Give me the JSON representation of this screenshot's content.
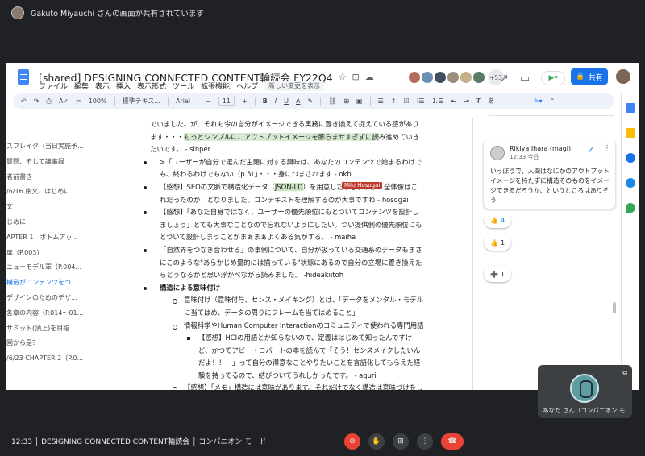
{
  "top_bar": {
    "text": "Gakuto Miyauchi さんの画面が共有されています"
  },
  "doc": {
    "title": "[shared] DESIGNING CONNECTED CONTENT輪読会 FY22Q4",
    "menus": [
      "ファイル",
      "編集",
      "表示",
      "挿入",
      "表示形式",
      "ツール",
      "拡張機能",
      "ヘルプ"
    ],
    "last_edit": "新しい変更を表示",
    "collaborator_count": "+53",
    "share_label": "共有"
  },
  "toolbar": {
    "zoom": "100%",
    "style": "標準テキス...",
    "font": "Arial",
    "font_size": "11",
    "bold": "B",
    "italic": "I",
    "underline": "U",
    "text_color": "A",
    "input_tools": "あ"
  },
  "outline": [
    {
      "label": "スブレイク（当日実施予..."
    },
    {
      "label": "質問、そして議事録"
    },
    {
      "label": "者前書き"
    },
    {
      "label": "/6/16 序文、はじめに..."
    },
    {
      "label": "文"
    },
    {
      "label": "じめに"
    },
    {
      "label": "APTER 1　ボトムアッ..."
    },
    {
      "label": "扉（P.003）"
    },
    {
      "label": "ニューモデル軍（P.004..."
    },
    {
      "label": "構造がコンテンツをつ..."
    },
    {
      "label": "デザインのためのデザ..."
    },
    {
      "label": "各章の内容（P.014〜01..."
    },
    {
      "label": "サミット(頂上)を目指..."
    },
    {
      "label": "固から是？"
    },
    {
      "label": "/6/23 CHAPTER 2（P.0..."
    }
  ],
  "body": {
    "l1a": "でいました。が、それも今の自分がイメージできる実務に置き換えて捉えている感",
    "l1b": "があります・・・",
    "l1c": "もっとシンプルに、アウトプットイメージを膨らませすぎずに読",
    "l1d": "み進めていきたいです。 - sinper",
    "b2": ">「ユーザーが自分で選んだ主題に対する興味は、あなたのコンテンツで始まるわけでも、終わるわけでもない（p.5）」・・・身につまされます - okb",
    "b3a": "【感想】SEOの文脈で構造化データ（",
    "b3b": "JSON-LD",
    "b3c": "）を用意したりしますが、全体像はこれだったのか！となりました。コンテキストを理解するのが大事ですね - hosogai",
    "b4": "【感想】「あなた自身ではなく、ユーザーの優先順位にもとづいてコンテンツを設計しましょう」とても大事なことなので忘れないようにしたい。つい提供側の優先順位にもとづいて設計しまうことがまぁまぁよくある気がする。 - maiha",
    "b5": "「自然界をつなぎ合わせる」の事例について、自分が扱っている交通系のデータもまさにこのような\"あらかじめ量的には揃っている\"状態にあるので自分の立場に置き換えたらどうなるかと思い浮かべながら読みました。 -hideakiitoh",
    "b6": "構造による意味付け",
    "s1": "意味付け（意味付与、センス・メイキング）とは、「データをメンタル・モデルに当てはめ、データの周りにフレームを当てはめること」",
    "s2": "情報科学やHuman Computer Interactionのコミュニティで使われる専門用語",
    "s3": "【感想】HCIの用語とか知らないので、定義ははじめて知ったんですけど、かつてアビー・コバートの本を読んで「そう！センスメイクしたいんだよ！！！」って自分の得意なことやりたいことを言語化してもらえた経験を持ってるので、結びついてうれしかったです。 - aguri",
    "s4": "【感想】「メモ」構造には意味があります。それだけでなく構造は意味づけをします。」情報やデータ単体でなく、関係性によって繋げることで意味を"
  },
  "cursor_label": "Miki Hosogai",
  "comment": {
    "name": "Rikiya Ihara (magi)",
    "time": "12:33 今日",
    "text": "いっぽうで、人間はなにかのアウトプットイメージを持たずに構造そのものをイメージできるだろうか、というところはありそう"
  },
  "reactions": [
    {
      "icon": "👍",
      "count": "4"
    },
    {
      "icon": "👍",
      "count": "1"
    },
    {
      "icon": "➕",
      "count": "1"
    }
  ],
  "self_view": {
    "label": "あなた さん（コンパニオン モ..."
  },
  "bottom": {
    "info": "12:33 │ DESIGNING CONNECTED CONTENT輪読会 │ コンパニオン モード"
  }
}
